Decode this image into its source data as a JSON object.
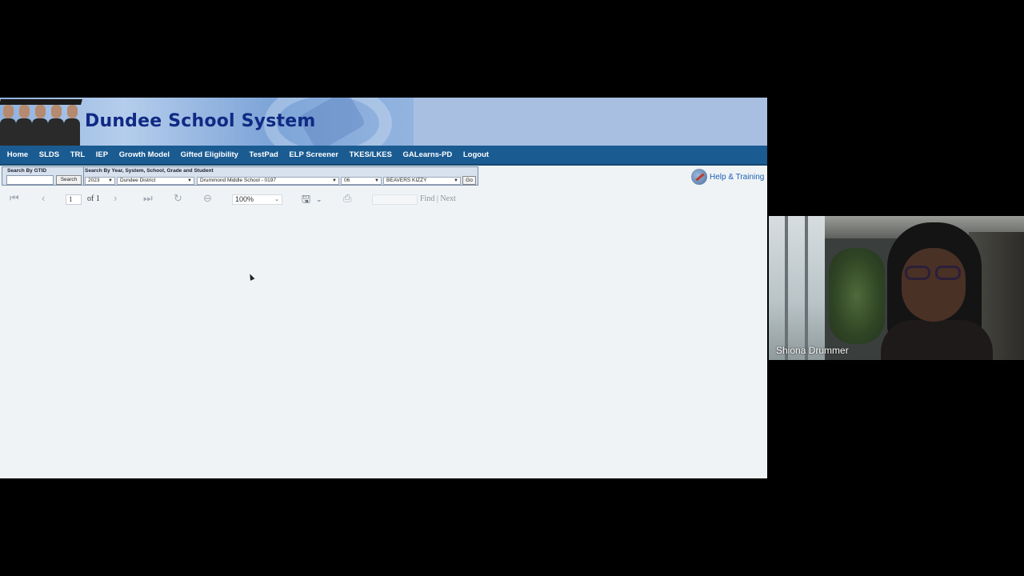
{
  "banner": {
    "title": "Dundee School System"
  },
  "nav": {
    "items": [
      "Home",
      "SLDS",
      "TRL",
      "IEP",
      "Growth Model",
      "Gifted Eligibility",
      "TestPad",
      "ELP Screener",
      "TKES/LKES",
      "GALearns-PD",
      "Logout"
    ]
  },
  "search": {
    "gtid_label": "Search By GTID",
    "gtid_button": "Search",
    "filters_label": "Search By Year, System, School, Grade and Student",
    "year": "2023",
    "system": "Dundee District",
    "school": "Drummond Middle School - 0197",
    "grade": "06",
    "student": "BEAVERS KIZZY",
    "go_button": "Go"
  },
  "help": {
    "label": "Help & Training",
    "icon": "help-tools-icon"
  },
  "report_toolbar": {
    "page_value": "1",
    "page_of": "of 1",
    "zoom": "100%",
    "find_next": "Find | Next",
    "icons": [
      "first-page-icon",
      "previous-page-icon",
      "next-page-icon",
      "last-page-icon",
      "refresh-icon",
      "back-icon",
      "save-icon",
      "print-icon"
    ]
  },
  "webcam": {
    "participant_name": "Shiona Drummer"
  },
  "colors": {
    "nav_bg": "#1a5b92",
    "title": "#102a84",
    "help_link": "#1e5fb3",
    "content_bg": "#eff3f6"
  }
}
